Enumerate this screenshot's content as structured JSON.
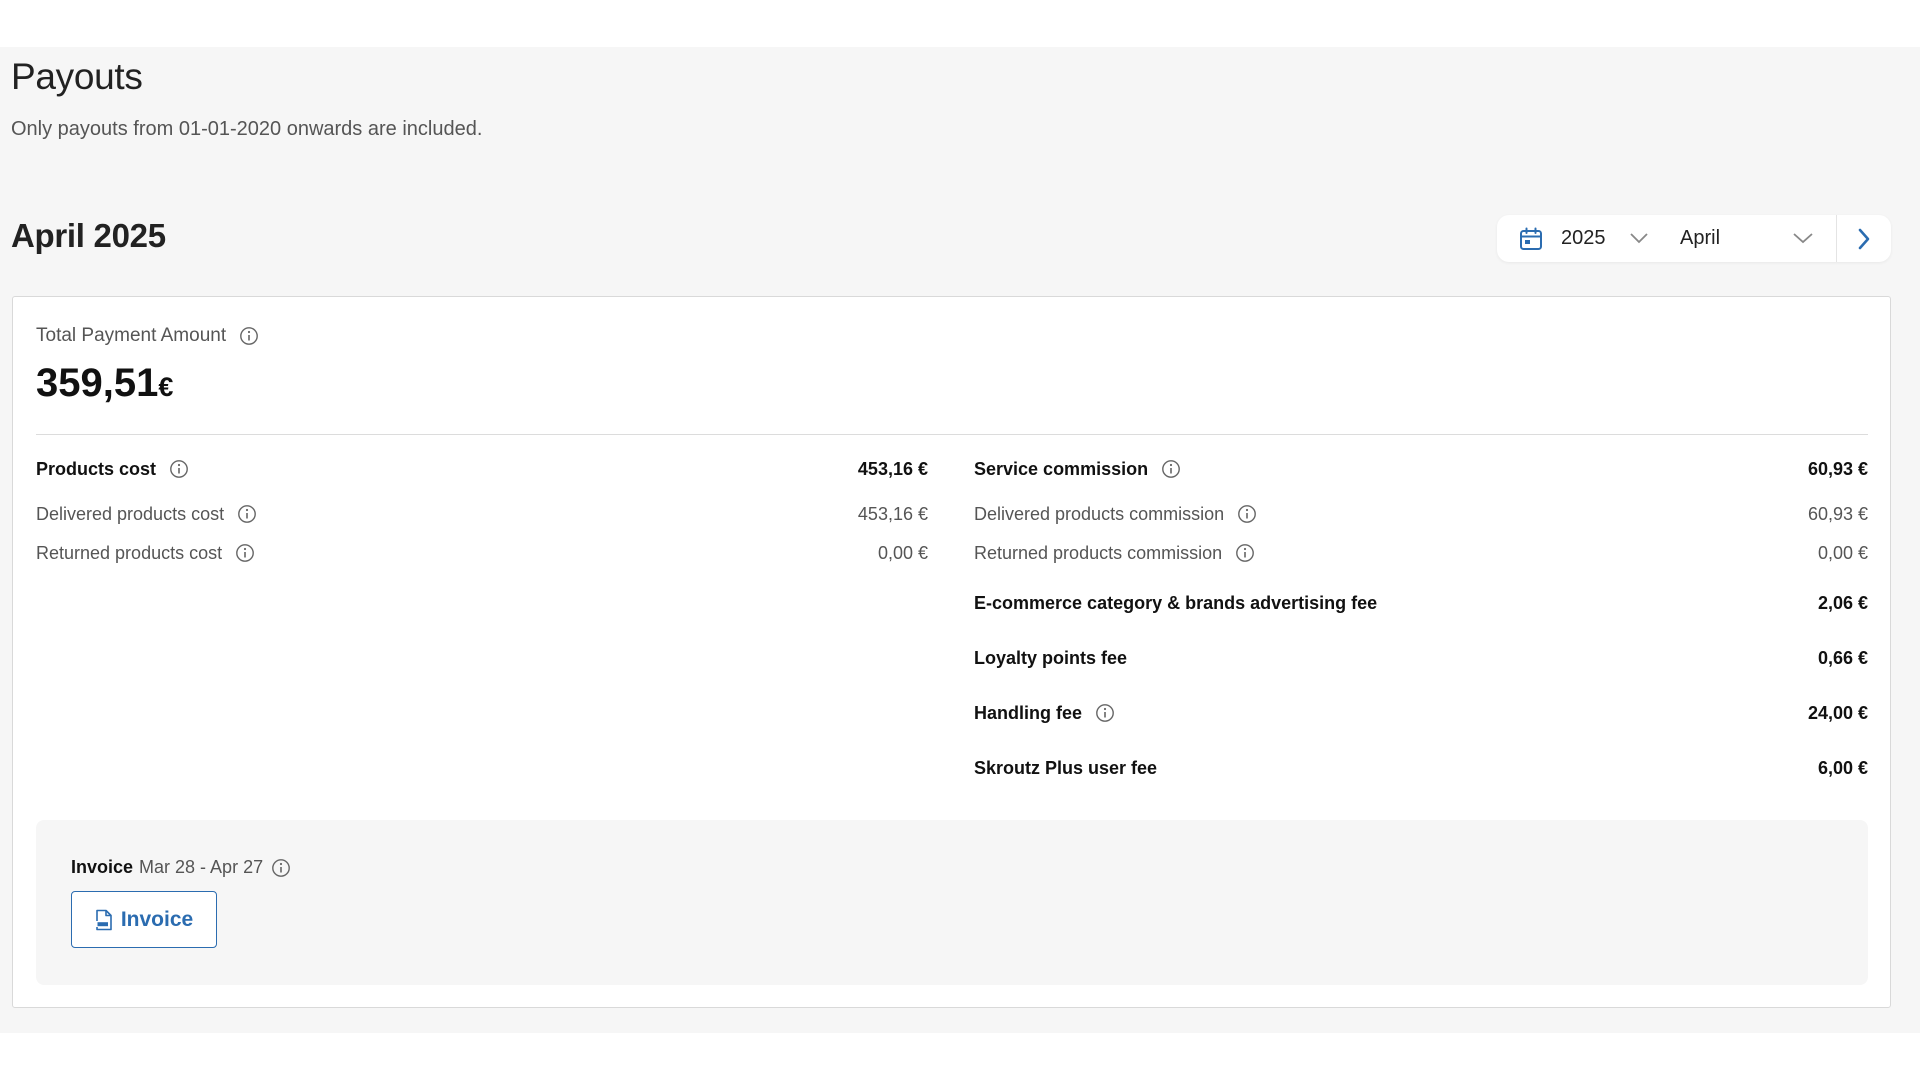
{
  "header": {
    "title": "Payouts",
    "subtitle": "Only payouts from 01-01-2020 onwards are included."
  },
  "period": {
    "title": "April 2025",
    "selector": {
      "year": "2025",
      "month": "April",
      "icons": [
        "calendar-icon",
        "chevron-down-icon",
        "chevron-right-icon"
      ]
    }
  },
  "summary": {
    "total_label": "Total Payment Amount",
    "total_value": "359,51",
    "total_currency": "€"
  },
  "left": {
    "products_cost": {
      "label": "Products cost",
      "value": "453,16 €"
    },
    "delivered_cost": {
      "label": "Delivered products cost",
      "value": "453,16 €"
    },
    "returned_cost": {
      "label": "Returned products cost",
      "value": "0,00 €"
    }
  },
  "right": {
    "service_commission": {
      "label": "Service commission",
      "value": "60,93 €"
    },
    "delivered_commission": {
      "label": "Delivered products commission",
      "value": "60,93 €"
    },
    "returned_commission": {
      "label": "Returned products commission",
      "value": "0,00 €"
    },
    "advertising_fee": {
      "label": "E-commerce category & brands advertising fee",
      "value": "2,06 €"
    },
    "loyalty_fee": {
      "label": "Loyalty points fee",
      "value": "0,66 €"
    },
    "handling_fee": {
      "label": "Handling fee",
      "value": "24,00 €"
    },
    "plus_fee": {
      "label": "Skroutz Plus user fee",
      "value": "6,00 €"
    }
  },
  "invoice": {
    "label": "Invoice",
    "range": "Mar 28 - Apr 27",
    "button_label": "Invoice"
  },
  "colors": {
    "accent": "#2b6cb0",
    "page_background": "#f6f6f6",
    "card_border": "#d9d9d9"
  }
}
